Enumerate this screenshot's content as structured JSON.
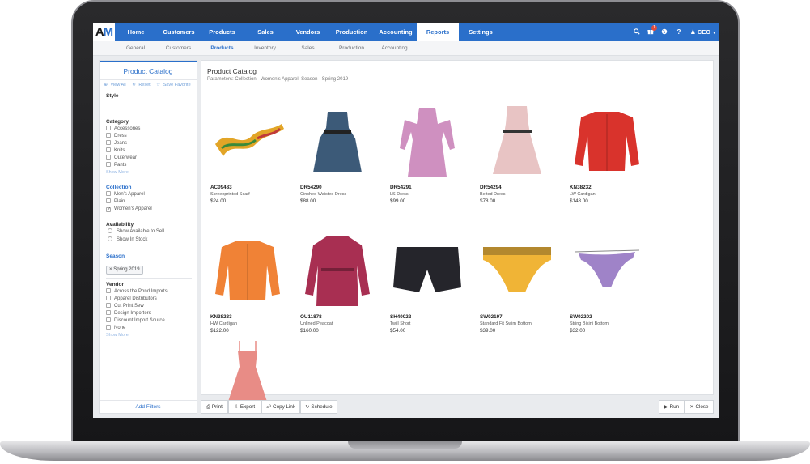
{
  "app": {
    "logo_a": "A",
    "logo_m": "M"
  },
  "nav": {
    "items": [
      "Home",
      "Customers",
      "Products",
      "Sales",
      "Vendors",
      "Production",
      "Accounting",
      "Reports",
      "Settings"
    ],
    "active": "Reports",
    "notification_count": "1",
    "user_label": "CEO"
  },
  "subnav": {
    "items": [
      "General",
      "Customers",
      "Products",
      "Inventory",
      "Sales",
      "Production",
      "Accounting"
    ],
    "active": "Products"
  },
  "sidebar": {
    "title": "Product Catalog",
    "actions": [
      "View All",
      "Reset",
      "Save Favorite"
    ],
    "style_label": "Style",
    "category_label": "Category",
    "categories": [
      "Accessories",
      "Dress",
      "Jeans",
      "Knits",
      "Outerwear",
      "Pants"
    ],
    "show_more": "Show More",
    "collection_label": "Collection",
    "collections": [
      {
        "label": "Men's Apparel",
        "checked": false
      },
      {
        "label": "Plain",
        "checked": false
      },
      {
        "label": "Women's Apparel",
        "checked": true
      }
    ],
    "availability_label": "Availability",
    "availability": [
      "Show Available to Sell",
      "Show In Stock"
    ],
    "season_label": "Season",
    "season_chip": "Spring 2019",
    "vendor_label": "Vendor",
    "vendors": [
      "Across the Pond Imports",
      "Apparel Distributors",
      "Cut Print Sew",
      "Design Importers",
      "Discount Import Source",
      "None"
    ],
    "vendor_show_more": "Show More",
    "add_filters": "Add Filters"
  },
  "report": {
    "title": "Product Catalog",
    "parameters": "Parameters: Collection - Women's Apparel, Season - Spring 2019",
    "products": [
      {
        "code": "AC09483",
        "name": "Screenprinted Scarf",
        "price": "$24.00",
        "icon": "scarf",
        "color": "#e2a527"
      },
      {
        "code": "DR54290",
        "name": "Cinched Waisted Dress",
        "price": "$88.00",
        "icon": "dress",
        "color": "#3c5a78"
      },
      {
        "code": "DR54291",
        "name": "LS Dress",
        "price": "$99.00",
        "icon": "long-dress",
        "color": "#cf90c0"
      },
      {
        "code": "DR54294",
        "name": "Belted Dress",
        "price": "$78.00",
        "icon": "belted-dress",
        "color": "#e8c4c4"
      },
      {
        "code": "KN38232",
        "name": "LW Cardigan",
        "price": "$148.00",
        "icon": "cardigan",
        "color": "#d9332c"
      },
      {
        "code": "KN38233",
        "name": "HW Cardigan",
        "price": "$122.00",
        "icon": "cardigan",
        "color": "#f08236"
      },
      {
        "code": "OU11878",
        "name": "Unlined Peacoat",
        "price": "$160.00",
        "icon": "coat",
        "color": "#a82f52"
      },
      {
        "code": "SH40022",
        "name": "Twill Short",
        "price": "$54.00",
        "icon": "shorts",
        "color": "#25252b"
      },
      {
        "code": "SW02197",
        "name": "Standard Fit Swim Bottom",
        "price": "$39.00",
        "icon": "swim-bottom",
        "color": "#f0b436"
      },
      {
        "code": "SW02202",
        "name": "String Bikini Bottom",
        "price": "$32.00",
        "icon": "bikini",
        "color": "#9f83c8"
      },
      {
        "code": "",
        "name": "",
        "price": "",
        "icon": "sundress",
        "color": "#e88c86"
      }
    ]
  },
  "toolbar": {
    "print": "Print",
    "export": "Export",
    "copy_link": "Copy Link",
    "schedule": "Schedule",
    "run": "Run",
    "close": "Close"
  }
}
